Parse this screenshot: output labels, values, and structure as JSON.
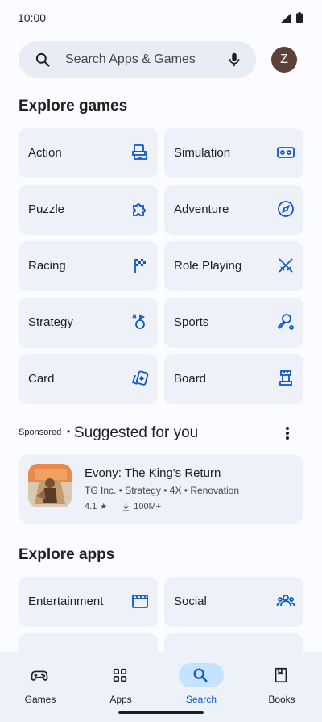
{
  "status": {
    "time": "10:00"
  },
  "search": {
    "placeholder": "Search Apps & Games",
    "avatar_letter": "Z"
  },
  "explore_games": {
    "title": "Explore games",
    "tiles": [
      {
        "label": "Action",
        "icon": "arcade-machine-icon"
      },
      {
        "label": "Simulation",
        "icon": "simulation-icon"
      },
      {
        "label": "Puzzle",
        "icon": "puzzle-piece-icon"
      },
      {
        "label": "Adventure",
        "icon": "compass-icon"
      },
      {
        "label": "Racing",
        "icon": "checkered-flag-icon"
      },
      {
        "label": "Role Playing",
        "icon": "crossed-swords-icon"
      },
      {
        "label": "Strategy",
        "icon": "strategy-icon"
      },
      {
        "label": "Sports",
        "icon": "sports-icon"
      },
      {
        "label": "Card",
        "icon": "playing-cards-icon"
      },
      {
        "label": "Board",
        "icon": "chess-rook-icon"
      }
    ]
  },
  "suggested": {
    "sponsored": "Sponsored",
    "title": "Suggested for you",
    "app": {
      "name": "Evony: The King's Return",
      "meta": "TG Inc. • Strategy • 4X • Renovation",
      "rating": "4.1",
      "downloads": "100M+"
    }
  },
  "explore_apps": {
    "title": "Explore apps",
    "tiles": [
      {
        "label": "Entertainment",
        "icon": "clapperboard-icon"
      },
      {
        "label": "Social",
        "icon": "group-icon"
      }
    ]
  },
  "bottom_nav": [
    {
      "label": "Games",
      "icon": "gamepad-icon",
      "active": false
    },
    {
      "label": "Apps",
      "icon": "apps-grid-icon",
      "active": false
    },
    {
      "label": "Search",
      "icon": "search-icon",
      "active": true
    },
    {
      "label": "Books",
      "icon": "book-icon",
      "active": false
    }
  ],
  "colors": {
    "accent": "#0b57d0",
    "tile_bg": "#eef2f8",
    "active_pill": "#c5e2ff"
  }
}
